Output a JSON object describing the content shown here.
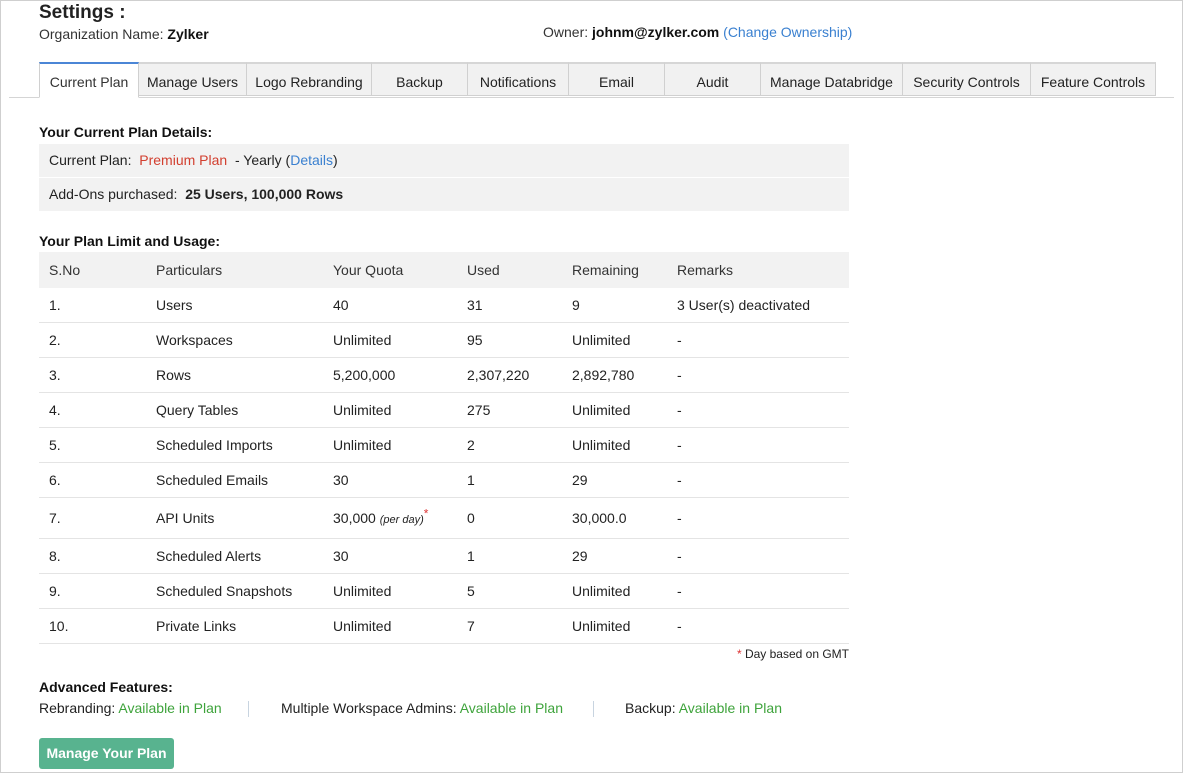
{
  "header": {
    "title": "Settings :",
    "org_label": "Organization Name:",
    "org_name": "Zylker",
    "owner_label": "Owner:",
    "owner_email": "johnm@zylker.com",
    "change_ownership": "(Change Ownership)"
  },
  "tabs": [
    {
      "label": "Current Plan",
      "active": true
    },
    {
      "label": "Manage Users"
    },
    {
      "label": "Logo Rebranding"
    },
    {
      "label": "Backup"
    },
    {
      "label": "Notifications"
    },
    {
      "label": "Email"
    },
    {
      "label": "Audit"
    },
    {
      "label": "Manage Databridge"
    },
    {
      "label": "Security Controls"
    },
    {
      "label": "Feature Controls"
    }
  ],
  "plan": {
    "heading": "Your Current Plan Details:",
    "current_label": "Current Plan:",
    "plan_name": "Premium Plan",
    "billing_prefix": "- Yearly (",
    "details_link": "Details",
    "billing_suffix": ")",
    "addons_label": "Add-Ons purchased:",
    "addons_value": "25 Users, 100,000 Rows"
  },
  "usage": {
    "heading": "Your Plan Limit and Usage:",
    "columns": [
      "S.No",
      "Particulars",
      "Your Quota",
      "Used",
      "Remaining",
      "Remarks"
    ],
    "rows": [
      {
        "sno": "1.",
        "particular": "Users",
        "quota": "40",
        "used": "31",
        "remaining": "9",
        "remarks": "3 User(s) deactivated"
      },
      {
        "sno": "2.",
        "particular": "Workspaces",
        "quota": "Unlimited",
        "used": "95",
        "remaining": "Unlimited",
        "remarks": "-"
      },
      {
        "sno": "3.",
        "particular": "Rows",
        "quota": "5,200,000",
        "used": "2,307,220",
        "remaining": "2,892,780",
        "remarks": "-"
      },
      {
        "sno": "4.",
        "particular": "Query Tables",
        "quota": "Unlimited",
        "used": "275",
        "remaining": "Unlimited",
        "remarks": "-"
      },
      {
        "sno": "5.",
        "particular": "Scheduled Imports",
        "quota": "Unlimited",
        "used": "2",
        "remaining": "Unlimited",
        "remarks": "-"
      },
      {
        "sno": "6.",
        "particular": "Scheduled Emails",
        "quota": "30",
        "used": "1",
        "remaining": "29",
        "remarks": "-"
      },
      {
        "sno": "7.",
        "particular": "API Units",
        "quota": "30,000",
        "quota_note": "(per day)",
        "quota_mark": "*",
        "used": "0",
        "remaining": "30,000.0",
        "remarks": "-"
      },
      {
        "sno": "8.",
        "particular": "Scheduled Alerts",
        "quota": "30",
        "used": "1",
        "remaining": "29",
        "remarks": "-"
      },
      {
        "sno": "9.",
        "particular": "Scheduled Snapshots",
        "quota": "Unlimited",
        "used": "5",
        "remaining": "Unlimited",
        "remarks": "-"
      },
      {
        "sno": "10.",
        "particular": "Private Links",
        "quota": "Unlimited",
        "used": "7",
        "remaining": "Unlimited",
        "remarks": "-"
      }
    ],
    "footnote_mark": "*",
    "footnote": "Day based on GMT"
  },
  "advanced": {
    "heading": "Advanced Features:",
    "items": [
      {
        "label": "Rebranding:",
        "status": "Available in Plan"
      },
      {
        "label": "Multiple Workspace Admins:",
        "status": "Available in Plan"
      },
      {
        "label": "Backup:",
        "status": "Available in Plan"
      }
    ]
  },
  "manage_button": "Manage Your Plan",
  "colors": {
    "link": "#3a80d0",
    "plan_name": "#d23f2f",
    "available": "#3ea33b",
    "button": "#58b38f",
    "active_tab": "#4b86d6"
  }
}
